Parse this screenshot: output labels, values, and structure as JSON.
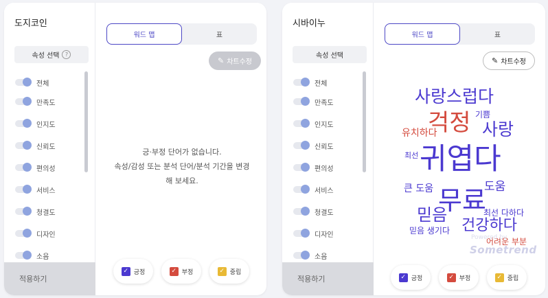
{
  "panels": [
    {
      "title": "도지코인",
      "attr_select_label": "속성 선택",
      "help_icon": "?",
      "attributes": [
        "전체",
        "만족도",
        "인지도",
        "신뢰도",
        "편의성",
        "서비스",
        "청결도",
        "디자인",
        "소음"
      ],
      "apply_label": "적용하기",
      "tabs": {
        "active": "워드 맵",
        "other": "표"
      },
      "edit_label": "차트수정",
      "empty_line1": "긍·부정 단어가 없습니다.",
      "empty_line2": "속성/감성 또는 분석 단어/분석 기간을 변경",
      "empty_line3": "해 보세요.",
      "legend": [
        {
          "label": "긍정",
          "color": "#4b39d0"
        },
        {
          "label": "부정",
          "color": "#d44b3e"
        },
        {
          "label": "중립",
          "color": "#e8b935"
        }
      ]
    },
    {
      "title": "시바이누",
      "attr_select_label": "속성 선택",
      "attributes": [
        "전체",
        "만족도",
        "인지도",
        "신뢰도",
        "편의성",
        "서비스",
        "청결도",
        "디자인",
        "소음"
      ],
      "apply_label": "적용하기",
      "tabs": {
        "active": "워드 맵",
        "other": "표"
      },
      "edit_label": "차트수정",
      "words": [
        {
          "text": "사랑스럽다",
          "sentiment": "positive"
        },
        {
          "text": "걱정",
          "sentiment": "negative"
        },
        {
          "text": "기쁨",
          "sentiment": "positive"
        },
        {
          "text": "사랑",
          "sentiment": "positive"
        },
        {
          "text": "유치하다",
          "sentiment": "negative"
        },
        {
          "text": "최선",
          "sentiment": "positive"
        },
        {
          "text": "귀엽다",
          "sentiment": "positive"
        },
        {
          "text": "큰 도움",
          "sentiment": "positive"
        },
        {
          "text": "도움",
          "sentiment": "positive"
        },
        {
          "text": "무료",
          "sentiment": "positive"
        },
        {
          "text": "믿음",
          "sentiment": "positive"
        },
        {
          "text": "최선 다하다",
          "sentiment": "positive"
        },
        {
          "text": "건강하다",
          "sentiment": "positive"
        },
        {
          "text": "믿음 생기다",
          "sentiment": "positive"
        },
        {
          "text": "어려운 부분",
          "sentiment": "negative"
        }
      ],
      "logo_text": "Sometrend",
      "logo_sub": "Powered by",
      "legend": [
        {
          "label": "긍정",
          "color": "#4b39d0"
        },
        {
          "label": "부정",
          "color": "#d44b3e"
        },
        {
          "label": "중립",
          "color": "#e8b935"
        }
      ]
    }
  ],
  "colors": {
    "positive": "#4b39d0",
    "negative": "#d44b3e",
    "neutral": "#e8b935",
    "accent": "#4b46c5"
  }
}
